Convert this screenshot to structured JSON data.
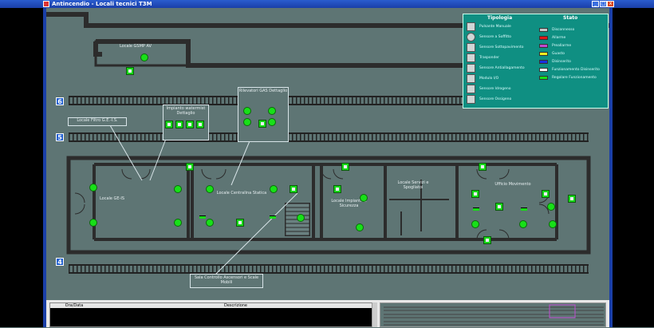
{
  "window": {
    "title": "Antincendio - Locali tecnici T3M",
    "min": "_",
    "max": "□",
    "close": "x"
  },
  "tracks": [
    {
      "number": "6"
    },
    {
      "number": "5"
    },
    {
      "number": "4"
    }
  ],
  "rooms": {
    "gsmp": "Locale GSMP AV",
    "ge_is": "Locale GE-IS",
    "centralina": "Locale Centralina Statica",
    "impianti": "Locale Impianti di Sicurezza",
    "servizi": "Locale Servizi e Spogliatoi",
    "movimento": "Ufficio Movimento"
  },
  "callouts": {
    "filtro": "Locale Filtro G.E.-I.S.",
    "waterm": "Impianto watermist Dettaglio",
    "rilevatori": "Rilevatori GAS Dettaglio",
    "sala": "Sala Controllo Ascensori e Scale Mobili"
  },
  "legend": {
    "tipologia_title": "Tipologia",
    "stato_title": "Stato",
    "tipologia": [
      {
        "label": "Pulsante Manuale",
        "icon": "manual-button-icon"
      },
      {
        "label": "Sensore a Soffitto",
        "icon": "ceiling-sensor-icon"
      },
      {
        "label": "Sensore Sottopavimento",
        "icon": "underfloor-sensor-icon"
      },
      {
        "label": "Trasponder",
        "icon": "transponder-icon"
      },
      {
        "label": "Sensore Antiallagamento",
        "icon": "flood-sensor-icon"
      },
      {
        "label": "Modulo I/O",
        "icon": "io-module-icon"
      },
      {
        "label": "Sensore Idrogeno",
        "icon": "hydrogen-sensor-icon"
      },
      {
        "label": "Sensore Ossigeno",
        "icon": "oxygen-sensor-icon"
      }
    ],
    "stato": [
      {
        "label": "Disconnesso",
        "color": "#c8c8c8"
      },
      {
        "label": "Allarme",
        "color": "#e01818"
      },
      {
        "label": "Preallarme",
        "color": "#c04ad0"
      },
      {
        "label": "Guasto",
        "color": "#f0f020"
      },
      {
        "label": "Disinserito",
        "color": "#1a30e0"
      },
      {
        "label": "Funzionamento Disinserito",
        "color": "#ffffff"
      },
      {
        "label": "Regolare Funzionamento",
        "color": "#18e018"
      }
    ]
  },
  "log": {
    "col1": "Ora/Data",
    "col2": "Descrizione"
  }
}
